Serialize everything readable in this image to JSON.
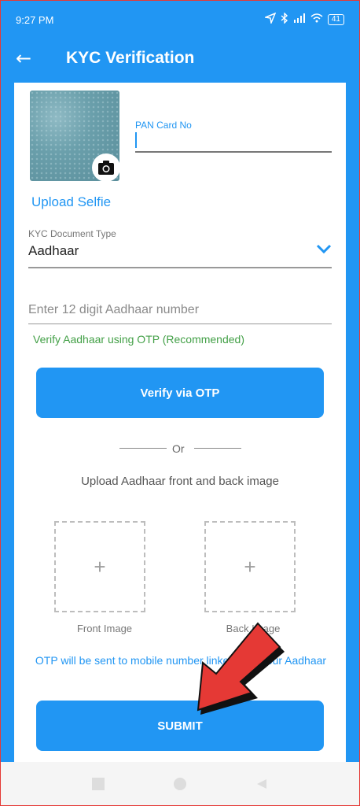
{
  "status_bar": {
    "time": "9:27 PM",
    "battery": "41",
    "icons": [
      "location-icon",
      "bluetooth-icon",
      "signal-icon",
      "wifi-icon",
      "battery-icon"
    ]
  },
  "app_bar": {
    "title": "KYC Verification",
    "back_icon": "back-arrow-icon"
  },
  "selfie": {
    "label": "Upload Selfie",
    "camera_icon": "camera-icon"
  },
  "pan": {
    "label": "PAN Card No",
    "value": ""
  },
  "kyc_doc": {
    "label": "KYC Document Type",
    "selected": "Aadhaar"
  },
  "aadhaar": {
    "placeholder": "Enter 12 digit Aadhaar number",
    "value": ""
  },
  "verify_note": "Verify Aadhaar using OTP (Recommended)",
  "verify_button": "Verify via OTP",
  "or_text": "Or",
  "upload_note": "Upload Aadhaar front and back image",
  "front_image": {
    "label": "Front Image",
    "plus": "+"
  },
  "back_image": {
    "label": "Back Image",
    "plus": "+"
  },
  "otp_note": "OTP will be sent to mobile number linked with your Aadhaar",
  "submit_button": "SUBMIT",
  "colors": {
    "primary": "#2196f3",
    "success": "#43a047",
    "annotation": "#e53935"
  }
}
